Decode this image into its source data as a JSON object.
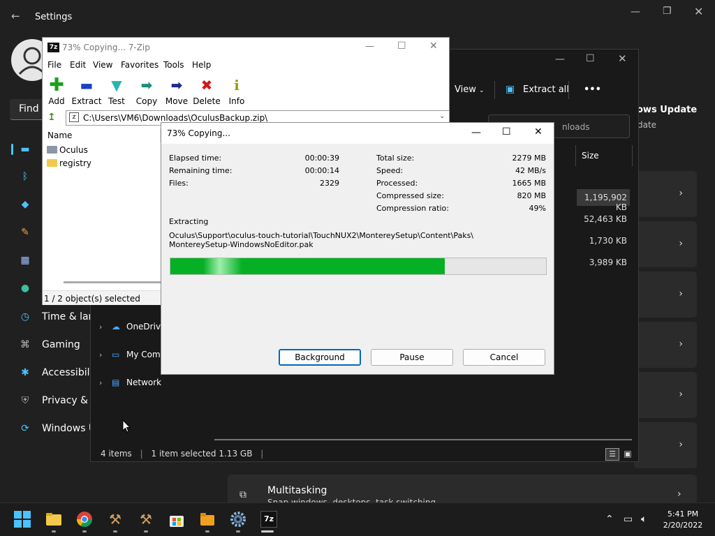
{
  "settings": {
    "title": "Settings",
    "find_placeholder": "Find a",
    "nav": [
      {
        "label": "Time & lang",
        "icon": "clock-globe-icon"
      },
      {
        "label": "Gaming",
        "icon": "gamepad-icon"
      },
      {
        "label": "Accessibility",
        "icon": "accessibility-icon"
      },
      {
        "label": "Privacy & s",
        "icon": "shield-icon"
      },
      {
        "label": "Windows U",
        "icon": "windows-update-icon"
      }
    ],
    "windows_update_title": "ows Update",
    "windows_update_sub": "date",
    "multitasking_title": "Multitasking",
    "multitasking_sub": "Snap windows, desktops, task switching"
  },
  "explorer": {
    "view_label": "View",
    "extract_all_label": "Extract all",
    "more_label": "•••",
    "search_placeholder": "nloads",
    "size_header": "Size",
    "sizes": [
      "1,195,902 KB",
      "52,463 KB",
      "1,730 KB",
      "3,989 KB"
    ],
    "tree": [
      {
        "label": "OneDrive"
      },
      {
        "label": "My Comp"
      },
      {
        "label": "Network"
      }
    ],
    "status_items": "4 items",
    "status_selected": "1 item selected  1.13 GB"
  },
  "sevenzip": {
    "title": "73% Copying... 7-Zip",
    "logo": "7z",
    "menu": [
      "File",
      "Edit",
      "View",
      "Favorites",
      "Tools",
      "Help"
    ],
    "toolbar": [
      {
        "label": "Add",
        "icon": "+",
        "color": "#1aa11a"
      },
      {
        "label": "Extract",
        "icon": "━",
        "color": "#1b3fbf"
      },
      {
        "label": "Test",
        "icon": "▼",
        "color": "#2ab3b3"
      },
      {
        "label": "Copy",
        "icon": "➡",
        "color": "#1f8b7a"
      },
      {
        "label": "Move",
        "icon": "➡",
        "color": "#1b2c8a"
      },
      {
        "label": "Delete",
        "icon": "✖",
        "color": "#d21a1a"
      },
      {
        "label": "Info",
        "icon": "i",
        "color": "#9a9a00"
      }
    ],
    "address": "C:\\Users\\VM6\\Downloads\\OculusBackup.zip\\",
    "list_header": "Name",
    "items": [
      {
        "name": "Oculus",
        "color": "#8a97a5"
      },
      {
        "name": "registry",
        "color": "#f2c94c"
      }
    ],
    "status": "1 / 2 object(s) selected"
  },
  "progress": {
    "title": "73% Copying...",
    "elapsed_label": "Elapsed time:",
    "elapsed_value": "00:00:39",
    "remaining_label": "Remaining time:",
    "remaining_value": "00:00:14",
    "files_label": "Files:",
    "files_value": "2329",
    "total_size_label": "Total size:",
    "total_size_value": "2279 MB",
    "speed_label": "Speed:",
    "speed_value": "42 MB/s",
    "processed_label": "Processed:",
    "processed_value": "1665 MB",
    "compressed_label": "Compressed size:",
    "compressed_value": "820 MB",
    "ratio_label": "Compression ratio:",
    "ratio_value": "49%",
    "operation": "Extracting",
    "path_line1": "Oculus\\Support\\oculus-touch-tutorial\\TouchNUX2\\MontereySetup\\Content\\Paks\\",
    "path_line2": "MontereySetup-WindowsNoEditor.pak",
    "percent": 73,
    "background_label": "Background",
    "pause_label": "Pause",
    "cancel_label": "Cancel"
  },
  "taskbar": {
    "time": "5:41 PM",
    "date": "2/20/2022"
  }
}
